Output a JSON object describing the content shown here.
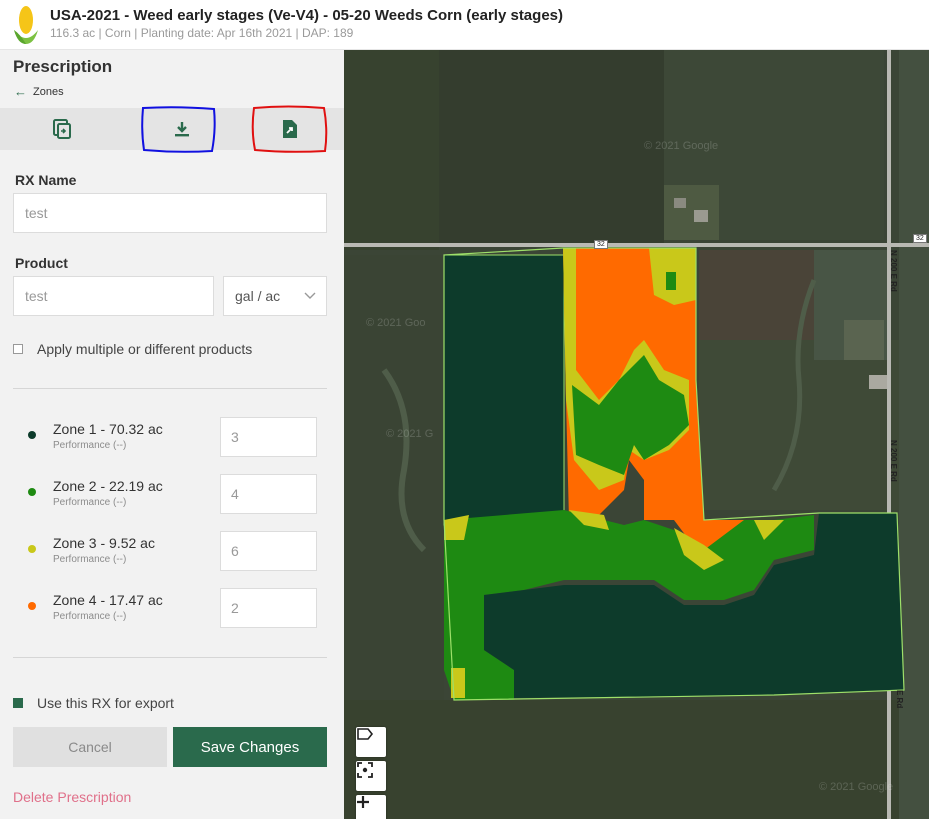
{
  "header": {
    "title": "USA-2021 - Weed early stages (Ve-V4) - 05-20 Weeds Corn (early stages)",
    "subtitle": "116.3 ac | Corn | Planting date: Apr 16th 2021 | DAP: 189"
  },
  "panel": {
    "title": "Prescription",
    "back_label": "Zones",
    "rx_name_label": "RX Name",
    "rx_name_value": "test",
    "product_label": "Product",
    "product_value": "test",
    "unit_selected": "gal / ac",
    "multi_product_label": "Apply multiple or different products",
    "use_export_label": "Use this RX for export",
    "cancel_label": "Cancel",
    "save_label": "Save Changes",
    "delete_label": "Delete Prescription"
  },
  "zones": [
    {
      "name": "Zone 1 - 70.32 ac",
      "performance": "Performance (--)",
      "rate": "3",
      "color": "#0d3b2b"
    },
    {
      "name": "Zone 2 - 22.19 ac",
      "performance": "Performance (--)",
      "rate": "4",
      "color": "#1e8a12"
    },
    {
      "name": "Zone 3 - 9.52 ac",
      "performance": "Performance (--)",
      "rate": "6",
      "color": "#c9c81a"
    },
    {
      "name": "Zone 4 - 17.47 ac",
      "performance": "Performance (--)",
      "rate": "2",
      "color": "#ff6a00"
    }
  ],
  "map": {
    "road_badge_1": "32",
    "road_badge_2": "32",
    "road_label_1": "N 200 E Rd",
    "road_label_2": "N 200 E Rd",
    "road_label_3": "E Rd",
    "watermark_1": "© 2021 Google",
    "watermark_2": "© 2021 Goo",
    "watermark_3": "© 2021 G",
    "watermark_4": "© 2021 Google"
  }
}
